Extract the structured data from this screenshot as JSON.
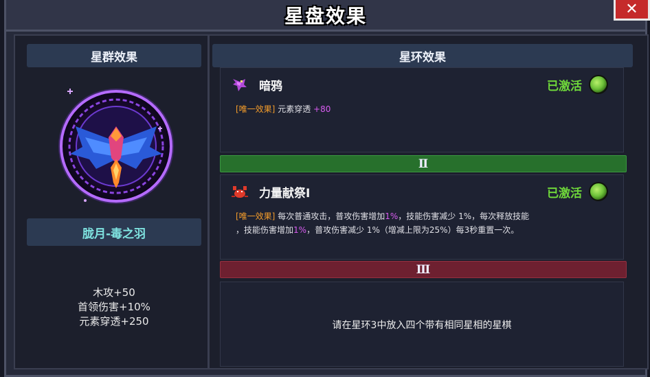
{
  "window": {
    "title": "星盘效果",
    "close_label": "✕"
  },
  "left_panel": {
    "header": "星群效果",
    "constellation_name": "胧月-毒之羽",
    "stats": [
      "木攻+50",
      "首领伤害+10%",
      "元素穿透+250"
    ]
  },
  "right_panel": {
    "header": "星环效果",
    "effects": [
      {
        "icon": "crow-icon",
        "name": "暗鸦",
        "status": "已激活",
        "tag": "[唯一效果]",
        "desc_text": "元素穿透 ",
        "desc_highlight": "+80"
      },
      {
        "icon": "crab-icon",
        "name": "力量献祭Ⅰ",
        "status": "已激活",
        "tag": "[唯一效果]",
        "line1_a": " 每次普通攻击，普攻伤害增加",
        "line1_hl": "1%",
        "line1_b": "，技能伤害减少 1%，每次释放技能",
        "line2_a": "，技能伤害增加",
        "line2_hl": "1%",
        "line2_b": "，普攻伤害减少 1%（增减上限为25%）每3秒重置一次。"
      }
    ],
    "tiers": [
      "Ⅱ",
      "Ⅲ"
    ],
    "hint": "请在星环3中放入四个带有相同星相的星棋"
  },
  "colors": {
    "activated": "#6fd83a",
    "tag": "#f29b2a",
    "highlight": "#d85cf0",
    "tier_ii": "#27702c",
    "tier_iii": "#6e2030",
    "name": "#7fe3e0"
  }
}
